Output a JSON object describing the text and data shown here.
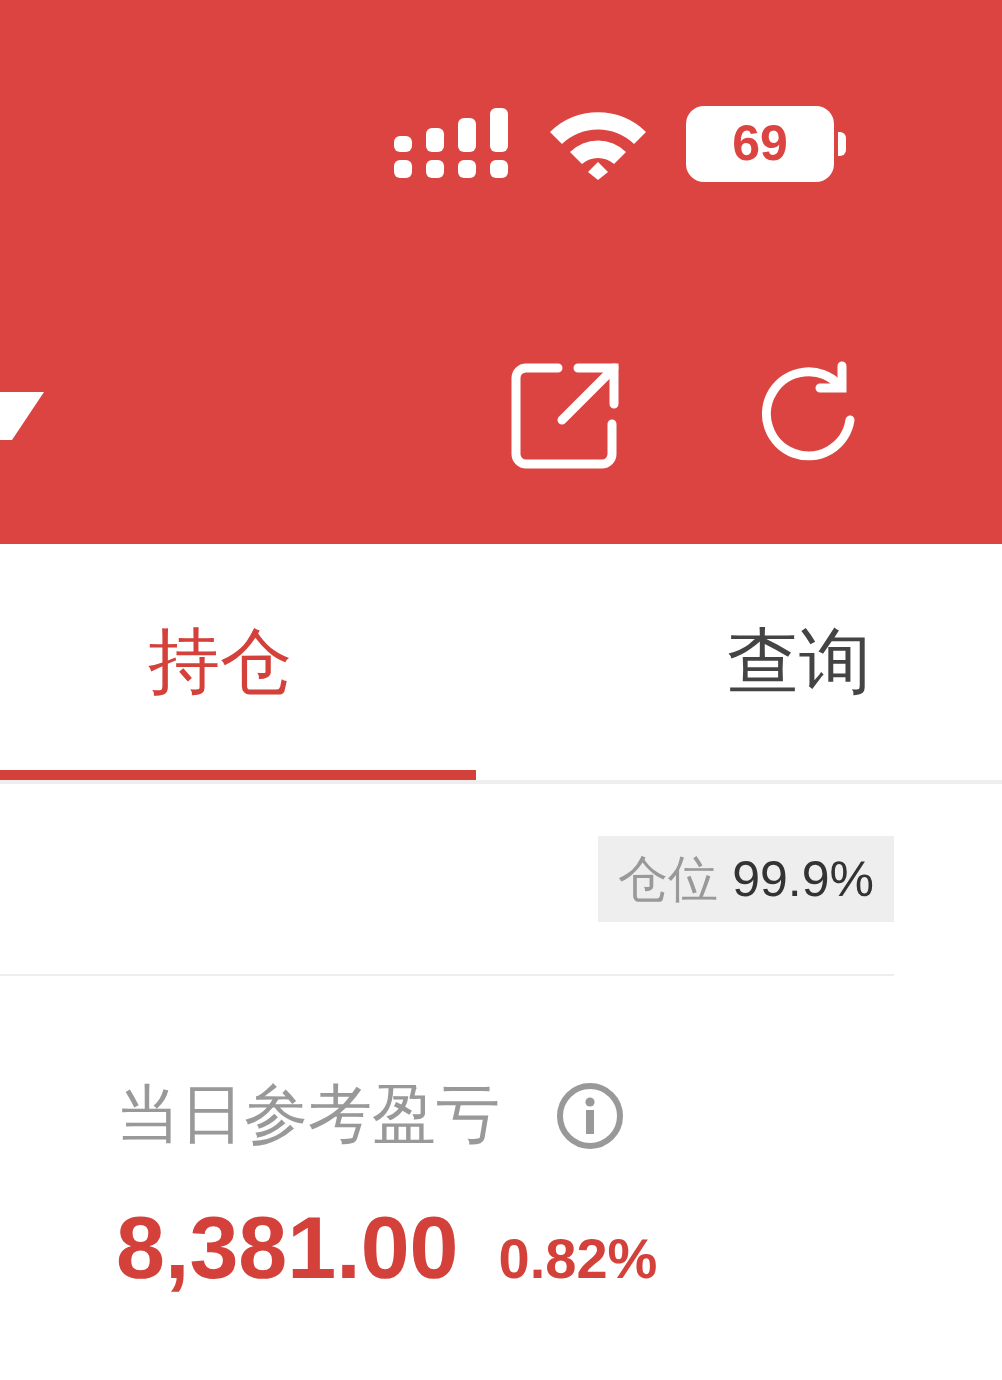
{
  "status_bar": {
    "battery": "69"
  },
  "tabs": [
    {
      "label": "持仓",
      "selected": true
    },
    {
      "label": "查询",
      "selected": false
    }
  ],
  "position": {
    "label": "仓位",
    "value": "99.9%"
  },
  "pnl": {
    "title": "当日参考盈亏",
    "value": "8,381.00",
    "percent": "0.82%"
  }
}
